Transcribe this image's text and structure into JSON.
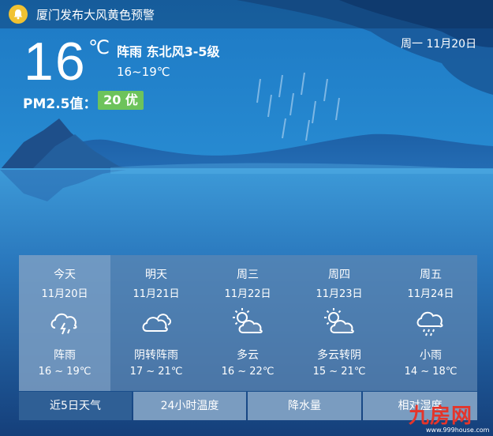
{
  "alert": {
    "text": "厦门发布大风黄色预警",
    "icon": "bell-icon",
    "icon_color": "#f1c232"
  },
  "current": {
    "temperature": "16",
    "unit": "℃",
    "condition_wind": "阵雨 东北风3-5级",
    "range": "16~19℃",
    "pm_label": "PM2.5值：",
    "pm_value": "20 优",
    "pm_color": "#6dc35b",
    "date": "周一 11月20日"
  },
  "forecast": [
    {
      "day": "今天",
      "date": "11月20日",
      "icon": "thunder-rain-icon",
      "condition": "阵雨",
      "range": "16 ~ 19℃"
    },
    {
      "day": "明天",
      "date": "11月21日",
      "icon": "cloudy-icon",
      "condition": "阴转阵雨",
      "range": "17 ~ 21℃"
    },
    {
      "day": "周三",
      "date": "11月22日",
      "icon": "partly-cloudy-icon",
      "condition": "多云",
      "range": "16 ~ 22℃"
    },
    {
      "day": "周四",
      "date": "11月23日",
      "icon": "partly-cloudy-icon",
      "condition": "多云转阴",
      "range": "15 ~ 21℃"
    },
    {
      "day": "周五",
      "date": "11月24日",
      "icon": "light-rain-icon",
      "condition": "小雨",
      "range": "14 ~ 18℃"
    }
  ],
  "tabs": [
    {
      "label": "近5日天气",
      "active": true
    },
    {
      "label": "24小时温度",
      "active": false
    },
    {
      "label": "降水量",
      "active": false
    },
    {
      "label": "相对湿度",
      "active": false
    }
  ],
  "watermark": {
    "logo": "九房网",
    "url": "www.999house.com"
  }
}
